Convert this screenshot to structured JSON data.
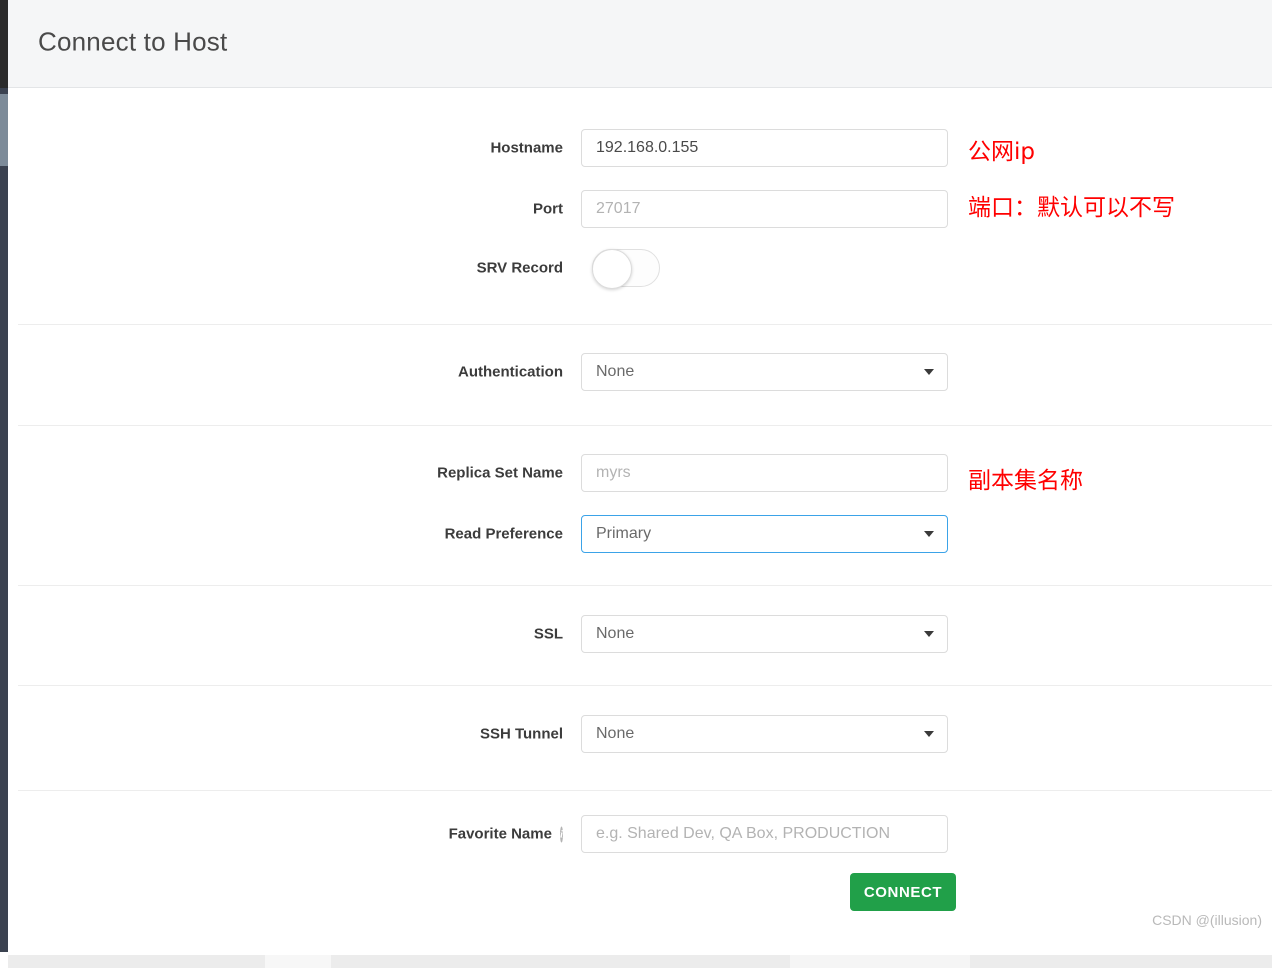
{
  "header": {
    "title": "Connect to Host"
  },
  "form": {
    "sections": [
      {
        "name": "host",
        "fields": [
          {
            "label": "Hostname",
            "type": "text",
            "value": "192.168.0.155",
            "placeholder": "",
            "annotation": "公网ip"
          },
          {
            "label": "Port",
            "type": "text",
            "value": "",
            "placeholder": "27017",
            "annotation": "端口：默认可以不写"
          },
          {
            "label": "SRV Record",
            "type": "toggle",
            "value": "off",
            "annotation": ""
          }
        ]
      },
      {
        "name": "authentication",
        "fields": [
          {
            "label": "Authentication",
            "type": "select",
            "value": "None",
            "annotation": ""
          }
        ]
      },
      {
        "name": "replica-set",
        "fields": [
          {
            "label": "Replica Set Name",
            "type": "text",
            "value": "",
            "placeholder": "myrs",
            "annotation": "副本集名称"
          },
          {
            "label": "Read Preference",
            "type": "select",
            "value": "Primary",
            "focused": true,
            "annotation": ""
          }
        ]
      },
      {
        "name": "ssl",
        "fields": [
          {
            "label": "SSL",
            "type": "select",
            "value": "None",
            "annotation": ""
          }
        ]
      },
      {
        "name": "ssh-tunnel",
        "fields": [
          {
            "label": "SSH Tunnel",
            "type": "select",
            "value": "None",
            "annotation": ""
          }
        ]
      },
      {
        "name": "favorite",
        "fields": [
          {
            "label": "Favorite Name",
            "type": "text",
            "value": "",
            "placeholder": "e.g. Shared Dev, QA Box, PRODUCTION",
            "info_icon": "info-icon",
            "annotation": ""
          }
        ]
      }
    ],
    "submit_label": "CONNECT"
  },
  "watermark": "CSDN @(illusion)",
  "colors": {
    "accent_green": "#21a049",
    "focus_blue": "#3ba3e8",
    "annotation_red": "#ff0000",
    "header_bg": "#f5f6f7",
    "rail_dark": "#3b4250"
  }
}
